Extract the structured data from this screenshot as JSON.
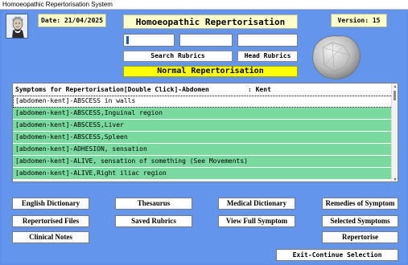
{
  "window": {
    "title": "Homoeopathic Repertorisation System"
  },
  "header": {
    "date_label": "Date: 21/04/2025",
    "title": "Homoeopathic Repertorisation",
    "version_label": "Version: 15",
    "logo_icon": "hahnemann-portrait-icon",
    "stone_icon": "crystal-stone-icon"
  },
  "search": {
    "input1_value": "",
    "input2_value": "",
    "input3_value": "",
    "search_button": "Search Rubrics",
    "head_button": "Head Rubrics",
    "mode_label": "Normal Repertorisation"
  },
  "list": {
    "header": "Symptoms for Repertorisation[Double Click]-Abdomen          : Kent",
    "items": [
      {
        "label": "[abdomen-kent]-ABSCESS in walls",
        "state": "selected"
      },
      {
        "label": "[abdomen-kent]-ABSCESS,Inguinal region",
        "state": "green"
      },
      {
        "label": "[abdomen-kent]-ABSCESS,Liver",
        "state": "green"
      },
      {
        "label": "[abdomen-kent]-ABSCESS,Spleen",
        "state": "green"
      },
      {
        "label": "[abdomen-kent]-ADHESION, sensation",
        "state": "green"
      },
      {
        "label": "[abdomen-kent]-ALIVE, sensation of something (See Movements)",
        "state": "green"
      },
      {
        "label": "[abdomen-kent]-ALIVE,Right iliac region",
        "state": "green"
      }
    ]
  },
  "buttons": {
    "english_dictionary": "English Dictionary",
    "thesaurus": "Thesaurus",
    "medical_dictionary": "Medical Dictionary",
    "remedies_of_symptom": "Remedies of Symptom",
    "repertorised_files": "Repertorised Files",
    "saved_rubrics": "Saved Rubrics",
    "view_full_symptom": "View Full Symptom",
    "selected_symptoms": "Selected Symptoms",
    "clinical_notes": "Clinical Notes",
    "repertorise": "Repertorise",
    "exit_continue": "Exit-Continue Selection"
  },
  "colors": {
    "background": "#6495ed",
    "label_yellow": "#ffffcc",
    "mode_yellow": "#ffff00",
    "row_green": "#79d99e"
  }
}
